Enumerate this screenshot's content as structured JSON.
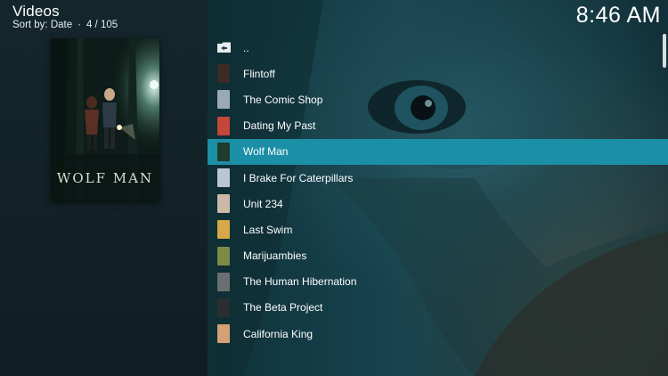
{
  "header": {
    "title": "Videos",
    "sort_label": "Sort by: Date",
    "position": "4 / 105",
    "clock": "8:46 AM"
  },
  "poster": {
    "title_text": "WOLF MAN"
  },
  "list": {
    "parent_label": "..",
    "items": [
      {
        "label": "Flintoff",
        "thumb_color": "#3b2a26"
      },
      {
        "label": "The Comic Shop",
        "thumb_color": "#9aa9b8"
      },
      {
        "label": "Dating My Past",
        "thumb_color": "#c5463a"
      },
      {
        "label": "Wolf Man",
        "thumb_color": "#1f3b2c",
        "selected": true
      },
      {
        "label": "I Brake For Caterpillars",
        "thumb_color": "#b9c6d6"
      },
      {
        "label": "Unit 234",
        "thumb_color": "#cbb9a8"
      },
      {
        "label": "Last Swim",
        "thumb_color": "#d6a84a"
      },
      {
        "label": "Marijuambies",
        "thumb_color": "#7c8a46"
      },
      {
        "label": "The Human Hibernation",
        "thumb_color": "#6b6f71"
      },
      {
        "label": "The Beta Project",
        "thumb_color": "#2b2d31"
      },
      {
        "label": "California King",
        "thumb_color": "#d3a173"
      }
    ]
  },
  "colors": {
    "selection": "#1b8fa6",
    "text": "#ffffff"
  }
}
